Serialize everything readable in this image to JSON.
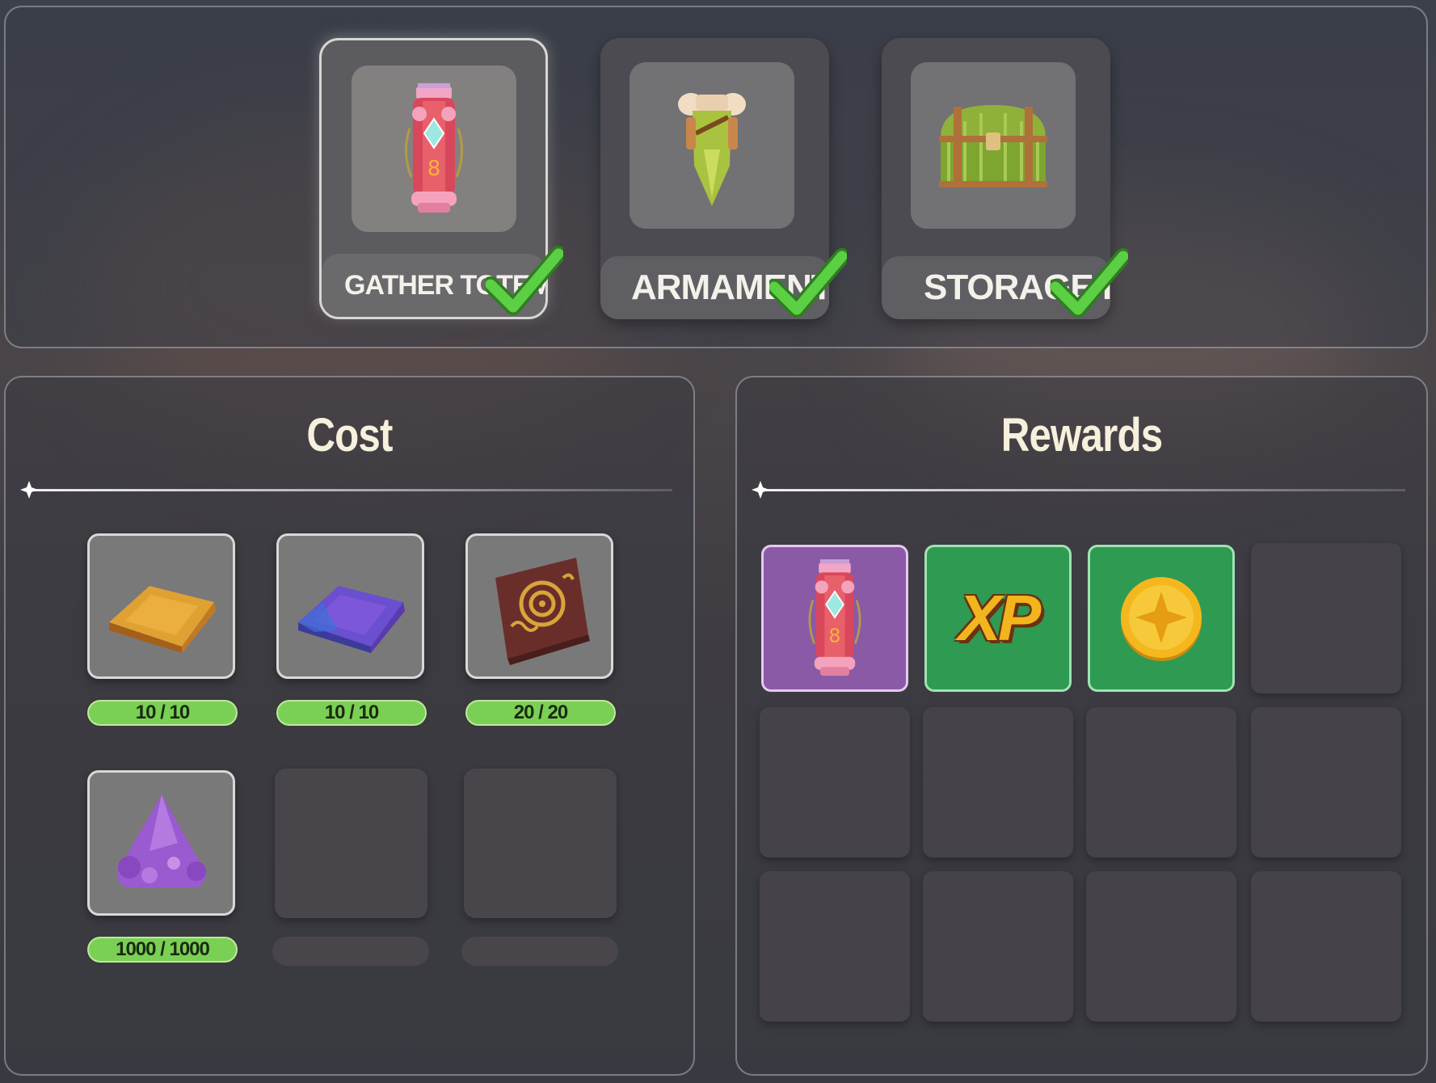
{
  "upgrades": [
    {
      "label": "GATHER TOTEM II",
      "icon": "totem-icon",
      "completed": true,
      "selected": true
    },
    {
      "label": "ARMAMENT II",
      "icon": "armor-icon",
      "completed": true,
      "selected": false
    },
    {
      "label": "STORAGE II",
      "icon": "chest-icon",
      "completed": true,
      "selected": false
    }
  ],
  "cost": {
    "title": "Cost",
    "items": [
      {
        "icon": "gold-ingot-icon",
        "progress": "10 / 10"
      },
      {
        "icon": "blue-ingot-icon",
        "progress": "10 / 10"
      },
      {
        "icon": "rune-tablet-icon",
        "progress": "20 / 20"
      },
      {
        "icon": "purple-crystal-icon",
        "progress": "1000 / 1000"
      }
    ]
  },
  "rewards": {
    "title": "Rewards",
    "items": [
      {
        "icon": "totem-icon",
        "rarity": "purple"
      },
      {
        "icon": "xp-icon",
        "text": "XP",
        "rarity": "green"
      },
      {
        "icon": "gold-coin-icon",
        "rarity": "green"
      }
    ]
  },
  "colors": {
    "progress_fill": "#7ad054",
    "check": "#4cc23a",
    "rare": "#8a5aa6",
    "common": "#2f9a52"
  }
}
